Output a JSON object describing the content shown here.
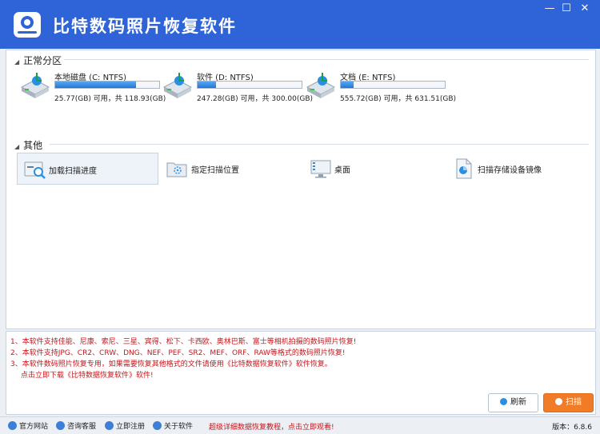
{
  "app": {
    "title": "比特数码照片恢复软件"
  },
  "window_controls": {
    "minimize": "—",
    "maximize": "☐",
    "close": "✕"
  },
  "partitions": {
    "header": "正常分区",
    "drives": [
      {
        "name": "本地磁盘 (C: NTFS)",
        "size_text": "25.77(GB) 可用，共 118.93(GB)",
        "used_fraction": 0.78
      },
      {
        "name": "软件 (D: NTFS)",
        "size_text": "247.28(GB) 可用，共 300.00(GB)",
        "used_fraction": 0.18
      },
      {
        "name": "文档 (E: NTFS)",
        "size_text": "555.72(GB) 可用，共 631.51(GB)",
        "used_fraction": 0.12
      }
    ]
  },
  "others": {
    "header": "其他",
    "items": [
      {
        "label": "加载扫描进度",
        "icon": "load-progress-icon"
      },
      {
        "label": "指定扫描位置",
        "icon": "location-folder-icon"
      },
      {
        "label": "桌面",
        "icon": "desktop-monitor-icon"
      },
      {
        "label": "扫描存储设备镜像",
        "icon": "disk-image-icon"
      }
    ]
  },
  "notes": [
    "1、本软件支持佳能、尼康、索尼、三星、宾得、松下、卡西欧、奥林巴斯、富士等相机拍摄的数码照片恢复!",
    "2、本软件支持JPG、CR2、CRW、DNG、NEF、PEF、SR2、MEF、ORF、RAW等格式的数码照片恢复!",
    "3、本软件数码照片恢复专用，如果需要恢复其他格式的文件请使用《比特数据恢复软件》软件恢复。",
    "点击立即下载《比特数据恢复软件》软件!"
  ],
  "buttons": {
    "refresh": "刷新",
    "scan": "扫描"
  },
  "statusbar": {
    "items": [
      "官方网站",
      "咨询客服",
      "立即注册",
      "关于软件"
    ],
    "promo": "超级详细数据恢复教程，点击立即观看!",
    "version": "版本：6.8.6"
  },
  "colors": {
    "title_bg": "#2f63d8",
    "accent_orange": "#f07c28",
    "note_red": "#c4161c",
    "bar_blue": "#1d77d8"
  }
}
